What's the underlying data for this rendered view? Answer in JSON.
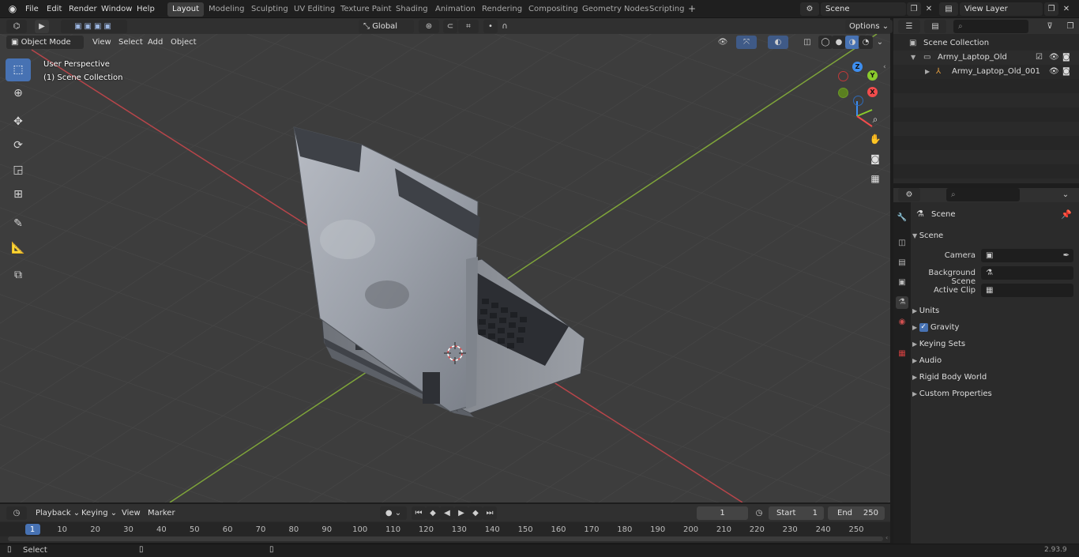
{
  "menus": [
    "File",
    "Edit",
    "Render",
    "Window",
    "Help"
  ],
  "workspace_tabs": [
    "Layout",
    "Modeling",
    "Sculpting",
    "UV Editing",
    "Texture Paint",
    "Shading",
    "Animation",
    "Rendering",
    "Compositing",
    "Geometry Nodes",
    "Scripting"
  ],
  "active_workspace": "Layout",
  "add_workspace": "+",
  "scene_field": "Scene",
  "view_layer_field": "View Layer",
  "viewport_header": {
    "mode": "Object Mode",
    "menu_view": "View",
    "menu_select": "Select",
    "menu_add": "Add",
    "menu_object": "Object",
    "orientation": "Global",
    "options": "Options"
  },
  "overlay": {
    "perspective": "User Perspective",
    "collection": "(1) Scene Collection"
  },
  "gizmo": {
    "z": "Z",
    "y": "Y",
    "x": "X"
  },
  "tools": [
    "select-box-tool",
    "cursor-tool",
    "move-tool",
    "rotate-tool",
    "scale-tool",
    "transform-tool",
    "annotate-tool",
    "measure-tool",
    "add-cube-tool"
  ],
  "outliner": {
    "root": "Scene Collection",
    "collection": "Army_Laptop_Old",
    "object": "Army_Laptop_Old_001"
  },
  "properties": {
    "context": "Scene",
    "panel_scene": "Scene",
    "camera_label": "Camera",
    "background_label": "Background Scene",
    "clip_label": "Active Clip",
    "panels": [
      "Units",
      "Gravity",
      "Keying Sets",
      "Audio",
      "Rigid Body World",
      "Custom Properties"
    ],
    "gravity_checked": true
  },
  "timeline": {
    "menus": [
      "Playback",
      "Keying",
      "View",
      "Marker"
    ],
    "current_frame": "1",
    "start_label": "Start",
    "start_value": "1",
    "end_label": "End",
    "end_value": "250",
    "ticks": [
      "1",
      "10",
      "20",
      "30",
      "40",
      "50",
      "60",
      "70",
      "80",
      "90",
      "100",
      "110",
      "120",
      "130",
      "140",
      "150",
      "160",
      "170",
      "180",
      "190",
      "200",
      "210",
      "220",
      "230",
      "240",
      "250"
    ]
  },
  "status": {
    "select": "Select",
    "version": "2.93.9"
  },
  "colors": {
    "accent": "#4772b3",
    "x_axis": "#b8454a",
    "y_axis": "#7fa53a",
    "gizmo_x": "#f34c4c",
    "gizmo_y": "#8acb2c",
    "gizmo_z": "#3d8ef0"
  }
}
